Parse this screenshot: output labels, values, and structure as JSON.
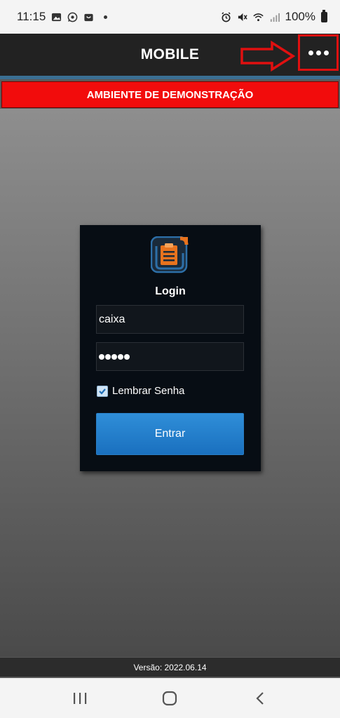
{
  "status_bar": {
    "time": "11:15",
    "battery": "100%",
    "icons_left": [
      "gallery-icon",
      "whatsapp-icon",
      "bag-icon"
    ],
    "icons_right": [
      "alarm-icon",
      "mute-icon",
      "wifi-icon",
      "signal-icon",
      "battery-icon"
    ]
  },
  "header": {
    "title": "MOBILE",
    "menu_icon": "more-horizontal-icon",
    "highlight_color": "#e01010"
  },
  "banner": {
    "text": "AMBIENTE DE DEMONSTRAÇÃO",
    "color": "#f20c0c"
  },
  "login": {
    "heading": "Login",
    "username_value": "caixa",
    "password_length": 5,
    "remember_label": "Lembrar Senha",
    "remember_checked": true,
    "submit_label": "Entrar",
    "button_color": "#1f78c8"
  },
  "footer": {
    "version": "Versão: 2022.06.14"
  },
  "nav_bar": {
    "buttons": [
      "recent-apps-icon",
      "home-icon",
      "back-icon"
    ]
  }
}
